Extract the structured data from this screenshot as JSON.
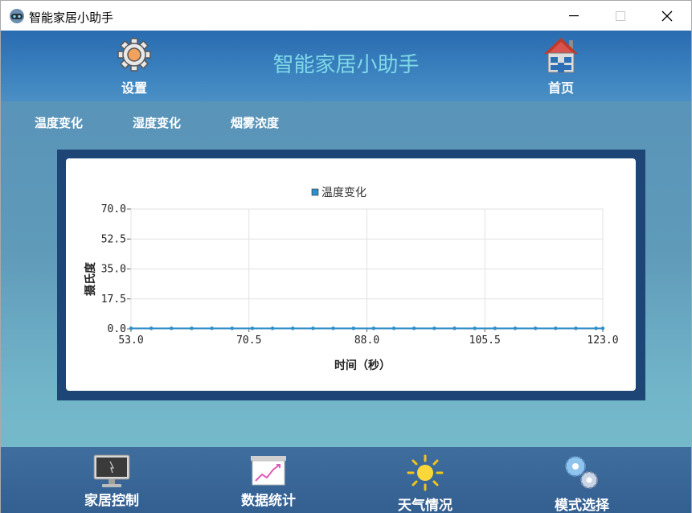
{
  "window": {
    "title": "智能家居小助手",
    "minimize_icon": "minimize-icon",
    "maximize_icon": "maximize-icon",
    "close_icon": "close-icon"
  },
  "header": {
    "title": "智能家居小助手",
    "settings_label": "设置",
    "home_label": "首页"
  },
  "tabs": [
    {
      "label": "温度变化"
    },
    {
      "label": "湿度变化"
    },
    {
      "label": "烟雾浓度"
    }
  ],
  "chart_data": {
    "type": "line",
    "title": "",
    "xlabel": "时间（秒）",
    "ylabel": "摄氏度",
    "legend": "top-center",
    "grid": true,
    "xlim": [
      53.0,
      123.0
    ],
    "ylim": [
      0.0,
      70.0
    ],
    "x_ticks": [
      "53.0",
      "70.5",
      "88.0",
      "105.5",
      "123.0"
    ],
    "y_ticks": [
      "0.0",
      "17.5",
      "35.0",
      "52.5",
      "70.0"
    ],
    "series": [
      {
        "name": "温度变化",
        "color": "#2d8ec9",
        "x": [
          53,
          56,
          59,
          62,
          65,
          68,
          71,
          74,
          77,
          80,
          83,
          86,
          89,
          92,
          95,
          98,
          101,
          104,
          107,
          110,
          113,
          116,
          119,
          122,
          123
        ],
        "y": [
          0.3,
          0.3,
          0.3,
          0.3,
          0.3,
          0.3,
          0.3,
          0.3,
          0.3,
          0.3,
          0.3,
          0.3,
          0.3,
          0.3,
          0.3,
          0.3,
          0.3,
          0.3,
          0.3,
          0.3,
          0.3,
          0.3,
          0.3,
          0.3,
          0.3
        ]
      }
    ]
  },
  "footer": {
    "items": [
      {
        "label": "家居控制",
        "icon": "monitor-icon"
      },
      {
        "label": "数据统计",
        "icon": "chart-board-icon"
      },
      {
        "label": "天气情况",
        "icon": "sun-icon"
      },
      {
        "label": "模式选择",
        "icon": "gears-icon"
      }
    ]
  },
  "colors": {
    "header": "#2a6bb0",
    "title_text": "#7fd9e8",
    "chart_frame": "#1d4677",
    "series": "#2d8ec9"
  }
}
